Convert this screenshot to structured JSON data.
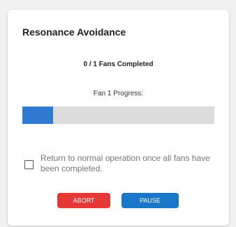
{
  "card": {
    "title": "Resonance Avoidance",
    "fans_completed": "0 / 1 Fans Completed",
    "fan_progress_label": "Fan 1 Progress:",
    "fan_progress_fraction": 0.16,
    "return_normal_label": "Return to normal operation once all fans have been completed.",
    "return_normal_checked": false
  },
  "buttons": {
    "abort_label": "ABORT",
    "pause_label": "PAUSE"
  },
  "colors": {
    "progress_fill": "#2f7bd1",
    "progress_track": "#dcdcdc",
    "abort": "#e53935",
    "pause": "#1976c9"
  }
}
